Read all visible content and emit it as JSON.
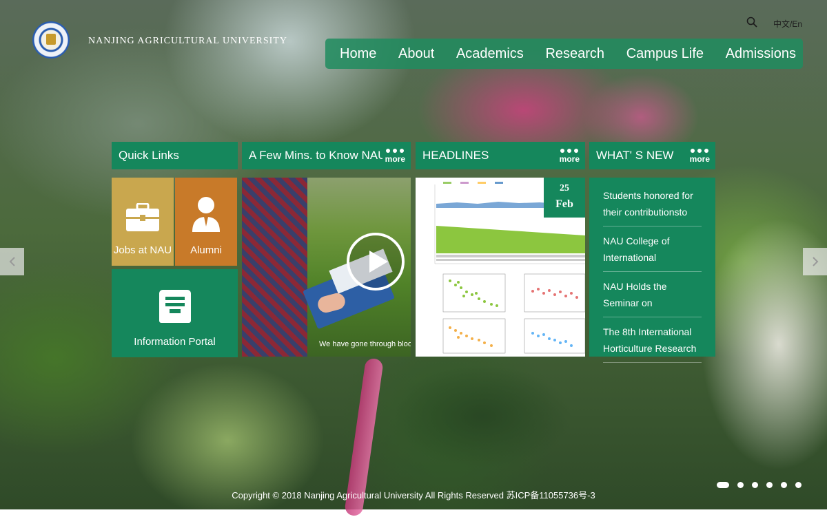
{
  "header": {
    "university_name": "NANJING AGRICULTURAL UNIVERSITY",
    "lang_zh": "中文",
    "lang_sep": "/",
    "lang_en": "En"
  },
  "nav": {
    "items": [
      {
        "label": "Home"
      },
      {
        "label": "About"
      },
      {
        "label": "Academics"
      },
      {
        "label": "Research"
      },
      {
        "label": "Campus Life"
      },
      {
        "label": "Admissions"
      }
    ]
  },
  "panels": {
    "quick_links": "Quick Links",
    "few_mins": "A Few Mins. to Know NAU",
    "headlines": "HEADLINES",
    "whats_new": "WHAT' S NEW",
    "more": "more"
  },
  "tiles": {
    "jobs": "Jobs at NAU",
    "alumni": "Alumni",
    "portal": "Information Portal"
  },
  "video": {
    "caption": "We have gone through blood, swea"
  },
  "headline": {
    "day": "25",
    "month": "Feb"
  },
  "news": [
    "Students honored for their contributionsto",
    "NAU College of International",
    "NAU Holds the Seminar on",
    "The 8th International Horticulture Research"
  ],
  "footer": {
    "copyright": "Copyright © 2018 Nanjing Agricultural University All Rights Reserved 苏ICP备11055736号-3"
  },
  "colors": {
    "accent": "#15875c",
    "jobs_tile": "#c9a74e",
    "alumni_tile": "#c87a29"
  }
}
